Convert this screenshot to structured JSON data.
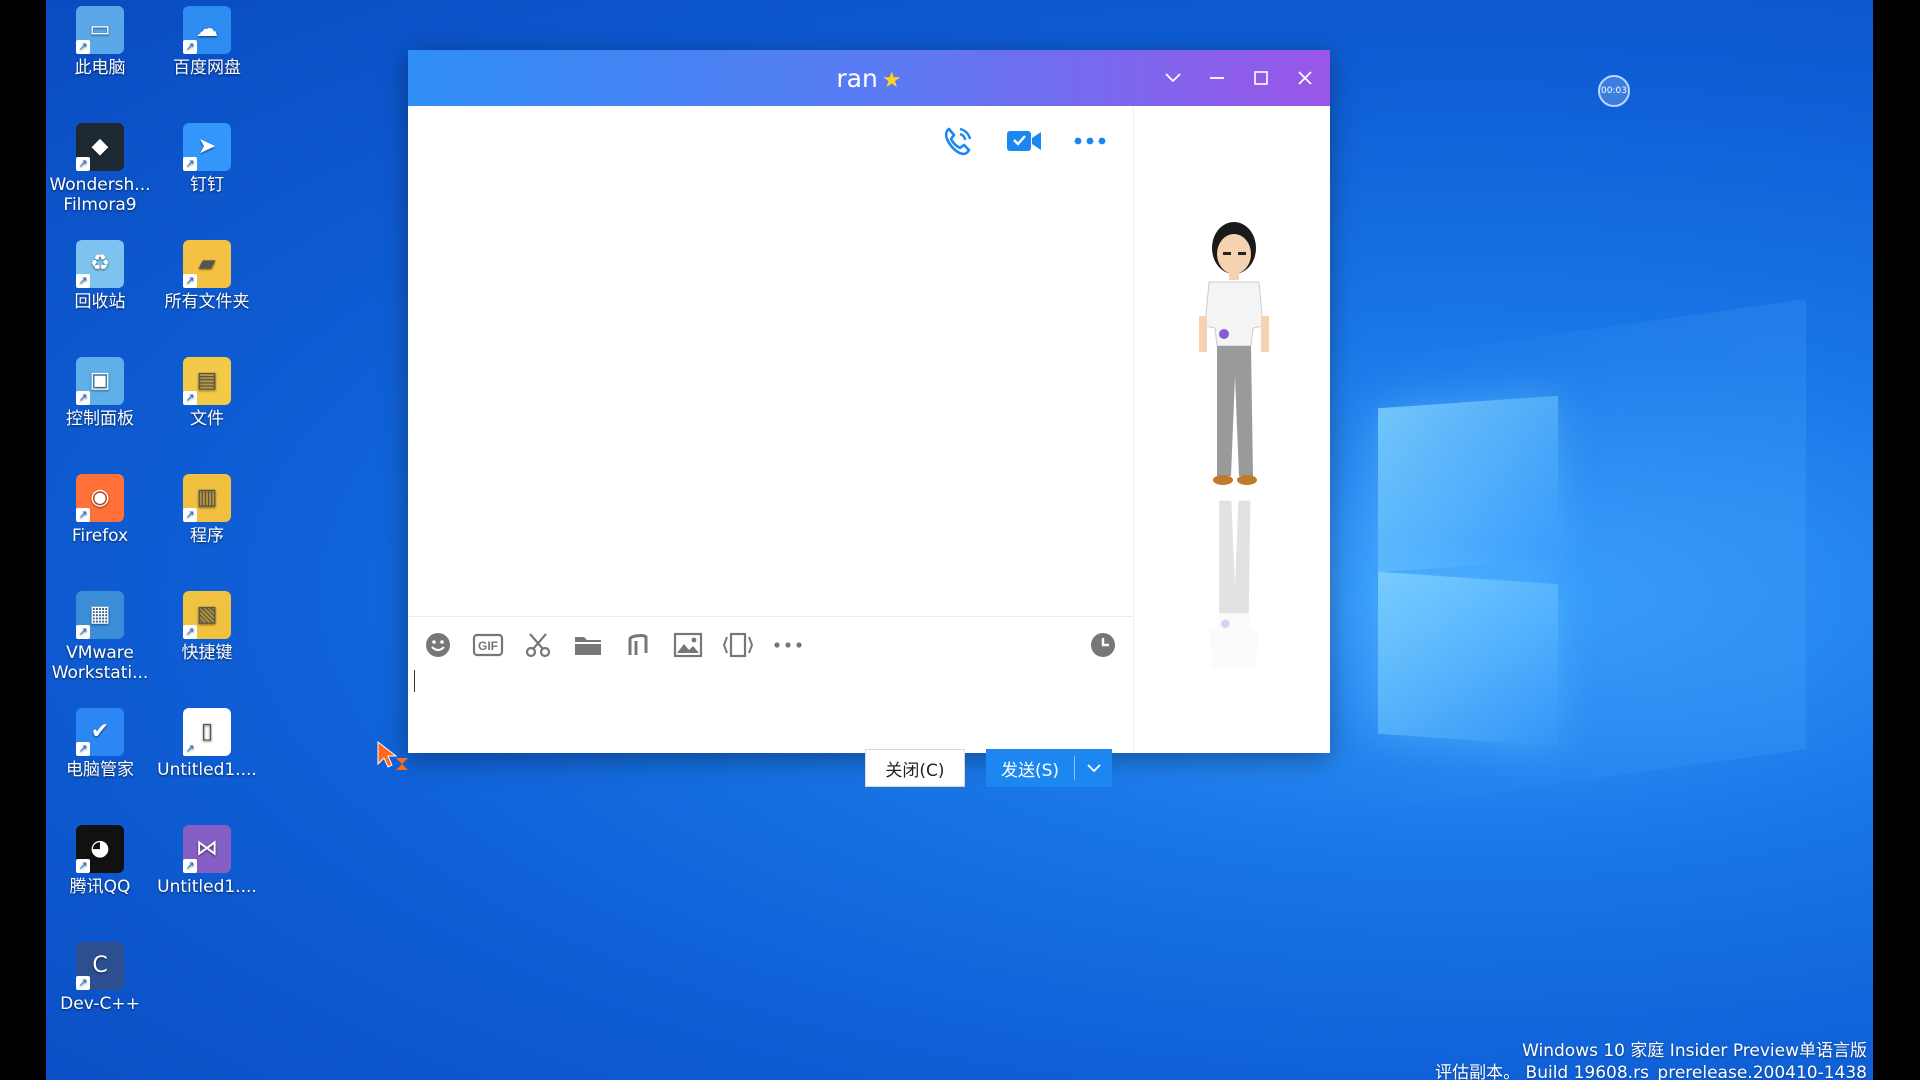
{
  "desktop": {
    "icons": [
      {
        "label": "此电脑",
        "icon": "computer-icon",
        "color": "#5aa8e8"
      },
      {
        "label": "百度网盘",
        "icon": "baidu-netdisk-icon",
        "color": "#2d8cf0"
      },
      {
        "label": "Wondersh... Filmora9",
        "icon": "filmora-icon",
        "color": "#1e2a33"
      },
      {
        "label": "钉钉",
        "icon": "dingtalk-icon",
        "color": "#3296fa"
      },
      {
        "label": "回收站",
        "icon": "recycle-bin-icon",
        "color": "#7ec3f0"
      },
      {
        "label": "所有文件夹",
        "icon": "folder-icon",
        "color": "#f4c242"
      },
      {
        "label": "控制面板",
        "icon": "control-panel-icon",
        "color": "#5fb0e8"
      },
      {
        "label": "文件",
        "icon": "file-icon",
        "color": "#f3c948"
      },
      {
        "label": "Firefox",
        "icon": "firefox-icon",
        "color": "#ff7139"
      },
      {
        "label": "程序",
        "icon": "program-icon",
        "color": "#f1c040"
      },
      {
        "label": "VMware Workstati...",
        "icon": "vmware-icon",
        "color": "#3b8dd8"
      },
      {
        "label": "快捷键",
        "icon": "shortcut-folder-icon",
        "color": "#f0c240"
      },
      {
        "label": "电脑管家",
        "icon": "pc-manager-icon",
        "color": "#2c86f4"
      },
      {
        "label": "Untitled1....",
        "icon": "document-icon",
        "color": "#ffffff"
      },
      {
        "label": "腾讯QQ",
        "icon": "qq-penguin-icon",
        "color": "#111111"
      },
      {
        "label": "Untitled1....",
        "icon": "visual-studio-icon",
        "color": "#865fc5"
      },
      {
        "label": "Dev-C++",
        "icon": "devcpp-icon",
        "color": "#2d4f8f"
      }
    ]
  },
  "chat": {
    "title": "ran",
    "star": "★",
    "window_controls": {
      "collapse": "chevron-down-icon",
      "minimize": "minimize-icon",
      "maximize": "maximize-icon",
      "close": "close-icon"
    },
    "top_tools": [
      "voice-call-icon",
      "video-call-icon",
      "more-icon"
    ],
    "toolbar": [
      "emoji-icon",
      "gif-icon",
      "screenshot-scissors-icon",
      "folder-icon",
      "music-note-icon",
      "image-icon",
      "screen-capture-icon",
      "more-icon"
    ],
    "history": "clock-icon",
    "input_value": "",
    "close_label": "关闭(C)",
    "send_label": "发送(S)"
  },
  "recorder": {
    "time": "00:03"
  },
  "watermark": {
    "line1": "Windows 10 家庭 Insider Preview单语言版",
    "line2": "评估副本。 Build 19608.rs_prerelease.200410-1438"
  },
  "colors": {
    "accent": "#1c87f0",
    "title_start": "#2f8ff4",
    "title_end": "#9a56e8"
  }
}
